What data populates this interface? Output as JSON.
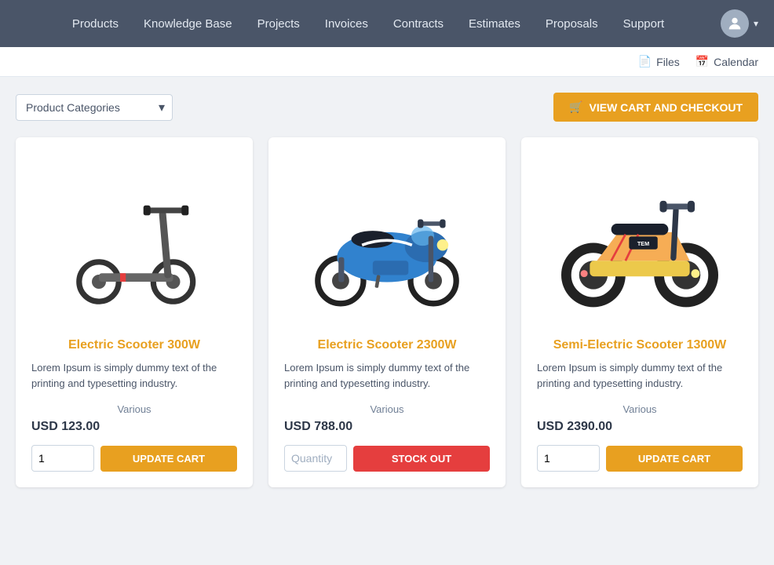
{
  "nav": {
    "items": [
      {
        "label": "Products",
        "id": "products"
      },
      {
        "label": "Knowledge Base",
        "id": "knowledge-base"
      },
      {
        "label": "Projects",
        "id": "projects"
      },
      {
        "label": "Invoices",
        "id": "invoices"
      },
      {
        "label": "Contracts",
        "id": "contracts"
      },
      {
        "label": "Estimates",
        "id": "estimates"
      },
      {
        "label": "Proposals",
        "id": "proposals"
      },
      {
        "label": "Support",
        "id": "support"
      }
    ]
  },
  "toolbar": {
    "files_label": "Files",
    "calendar_label": "Calendar"
  },
  "controls": {
    "category_placeholder": "Product Categories",
    "view_cart_label": "VIEW CART AND CHECKOUT"
  },
  "products": [
    {
      "id": "scooter-300w",
      "name": "Electric Scooter 300W",
      "description": "Lorem Ipsum is simply dummy text of the printing and typesetting industry.",
      "variant": "Various",
      "price": "USD 123.00",
      "qty_value": "1",
      "qty_placeholder": "",
      "action": "update",
      "action_label": "UPDATE CART",
      "color": "#e8a020"
    },
    {
      "id": "scooter-2300w",
      "name": "Electric Scooter 2300W",
      "description": "Lorem Ipsum is simply dummy text of the printing and typesetting industry.",
      "variant": "Various",
      "price": "USD 788.00",
      "qty_value": "",
      "qty_placeholder": "Quantity",
      "action": "stockout",
      "action_label": "STOCK OUT",
      "color": "#e8a020"
    },
    {
      "id": "semi-scooter-1300w",
      "name": "Semi-Electric Scooter 1300W",
      "description": "Lorem Ipsum is simply dummy text of the printing and typesetting industry.",
      "variant": "Various",
      "price": "USD 2390.00",
      "qty_value": "1",
      "qty_placeholder": "",
      "action": "update",
      "action_label": "UPDATE CART",
      "color": "#e8a020"
    }
  ]
}
